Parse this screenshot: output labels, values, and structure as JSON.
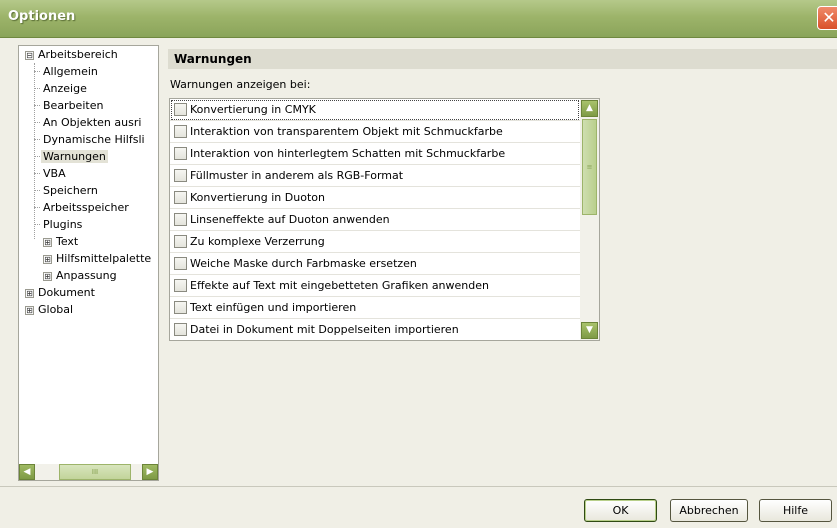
{
  "window": {
    "title": "Optionen",
    "close_icon": "close-icon"
  },
  "tree": {
    "items": [
      {
        "label": "Arbeitsbereich",
        "expander": "⊟"
      },
      {
        "label": "Allgemein"
      },
      {
        "label": "Anzeige"
      },
      {
        "label": "Bearbeiten"
      },
      {
        "label": "An Objekten ausri"
      },
      {
        "label": "Dynamische Hilfsli"
      },
      {
        "label": "Warnungen"
      },
      {
        "label": "VBA"
      },
      {
        "label": "Speichern"
      },
      {
        "label": "Arbeitsspeicher"
      },
      {
        "label": "Plugins"
      },
      {
        "label": "Text",
        "expander": "⊞"
      },
      {
        "label": "Hilfsmittelpalette",
        "expander": "⊞"
      },
      {
        "label": "Anpassung",
        "expander": "⊞"
      },
      {
        "label": "Dokument",
        "expander": "⊞"
      },
      {
        "label": "Global",
        "expander": "⊞"
      }
    ],
    "selected": "Warnungen",
    "scroll_thumb_glyph": "III"
  },
  "panel": {
    "title": "Warnungen",
    "subheading": "Warnungen anzeigen bei:",
    "warnings": [
      {
        "label": "Konvertierung in CMYK",
        "checked": false
      },
      {
        "label": "Interaktion von transparentem Objekt mit Schmuckfarbe",
        "checked": false
      },
      {
        "label": "Interaktion von hinterlegtem Schatten mit Schmuckfarbe",
        "checked": false
      },
      {
        "label": "Füllmuster in anderem als RGB-Format",
        "checked": false
      },
      {
        "label": "Konvertierung in Duoton",
        "checked": false
      },
      {
        "label": "Linseneffekte auf Duoton anwenden",
        "checked": false
      },
      {
        "label": "Zu komplexe Verzerrung",
        "checked": false
      },
      {
        "label": "Weiche Maske durch Farbmaske ersetzen",
        "checked": false
      },
      {
        "label": "Effekte auf Text mit eingebetteten Grafiken anwenden",
        "checked": false
      },
      {
        "label": "Text einfügen und importieren",
        "checked": false
      },
      {
        "label": "Datei in Dokument mit Doppelseiten importieren",
        "checked": false
      }
    ],
    "scroll_thumb_glyph": "≡"
  },
  "buttons": {
    "ok": "OK",
    "cancel": "Abbrechen",
    "help": "Hilfe"
  },
  "colors": {
    "titlebar": "#9db46a",
    "accent": "#7e9a45",
    "selection": "#e3e2d6"
  }
}
